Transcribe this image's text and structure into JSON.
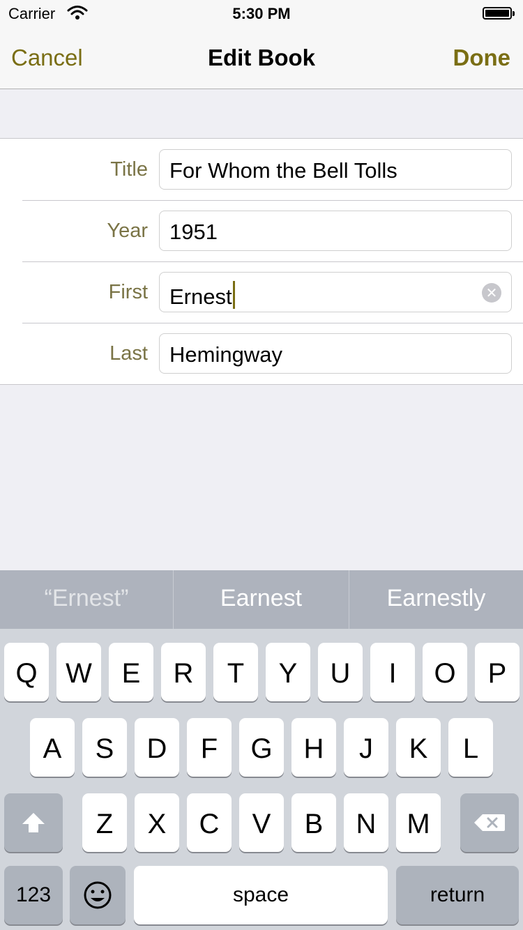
{
  "status_bar": {
    "carrier": "Carrier",
    "time": "5:30 PM"
  },
  "nav": {
    "cancel": "Cancel",
    "title": "Edit Book",
    "done": "Done"
  },
  "form": {
    "rows": [
      {
        "label": "Title",
        "value": "For Whom the Bell Tolls"
      },
      {
        "label": "Year",
        "value": "1951"
      },
      {
        "label": "First",
        "value": "Ernest"
      },
      {
        "label": "Last",
        "value": "Hemingway"
      }
    ]
  },
  "keyboard": {
    "suggestions": [
      "“Ernest”",
      "Earnest",
      "Earnestly"
    ],
    "row1": [
      "Q",
      "W",
      "E",
      "R",
      "T",
      "Y",
      "U",
      "I",
      "O",
      "P"
    ],
    "row2": [
      "A",
      "S",
      "D",
      "F",
      "G",
      "H",
      "J",
      "K",
      "L"
    ],
    "row3": [
      "Z",
      "X",
      "C",
      "V",
      "B",
      "N",
      "M"
    ],
    "numbers": "123",
    "space": "space",
    "return": "return"
  },
  "colors": {
    "accent": "#7a6e14",
    "label": "#7a7446",
    "background": "#efeff4"
  }
}
